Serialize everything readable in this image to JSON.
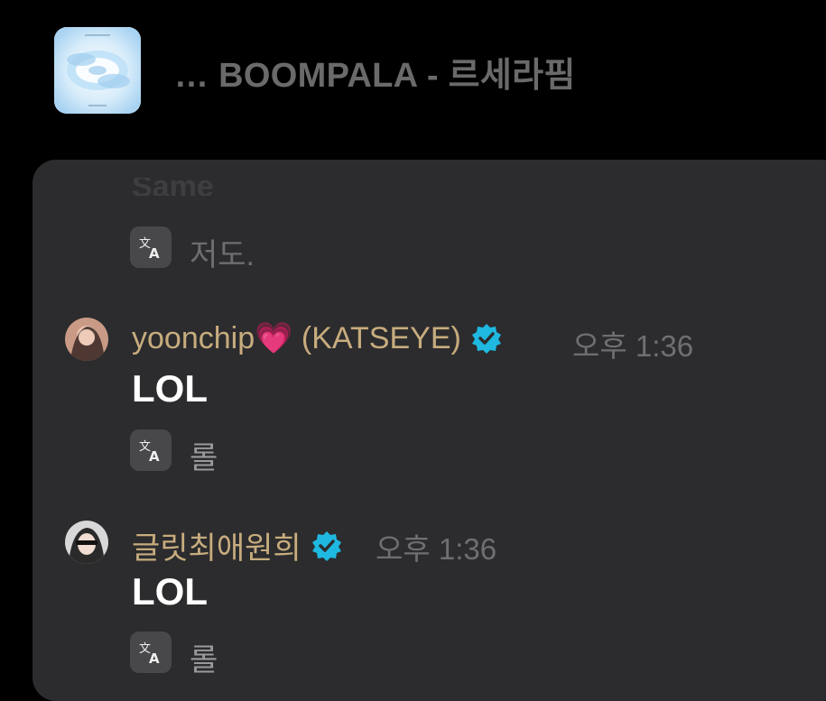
{
  "header": {
    "title": "… BOOMPALA - 르세라핌",
    "album_art_icon": "album-art-clouds"
  },
  "chat": {
    "previous_message": {
      "partial_text": "Same",
      "translation": "저도."
    },
    "messages": [
      {
        "username": "yoonchip💗 (KATSEYE)",
        "verified": true,
        "timestamp": "오후 1:36",
        "text": "LOL",
        "translation": "롤"
      },
      {
        "username": "글릿최애원희",
        "verified": true,
        "timestamp": "오후 1:36",
        "text": "LOL",
        "translation": "롤"
      }
    ]
  },
  "colors": {
    "background": "#000000",
    "panel": "#2c2c2e",
    "username": "#c7ac7e",
    "verified": "#1fb8e0",
    "message_text": "#ffffff"
  }
}
